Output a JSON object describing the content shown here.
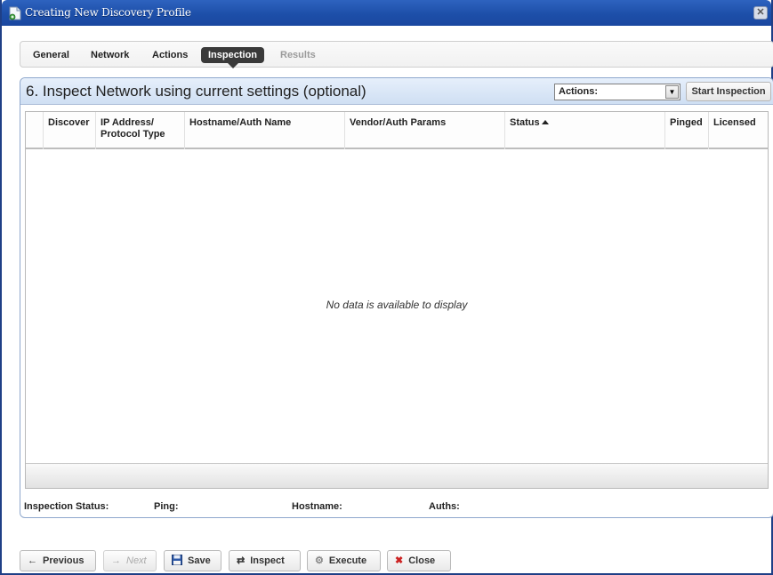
{
  "window": {
    "title": "Creating New Discovery Profile",
    "close_glyph": "✕"
  },
  "tabs": [
    {
      "label": "General",
      "state": "normal"
    },
    {
      "label": "Network",
      "state": "normal"
    },
    {
      "label": "Actions",
      "state": "normal"
    },
    {
      "label": "Inspection",
      "state": "active"
    },
    {
      "label": "Results",
      "state": "disabled"
    }
  ],
  "panel": {
    "title": "6. Inspect Network using current settings (optional)",
    "actions_select": {
      "value": "Actions:"
    },
    "start_button": "Start Inspection"
  },
  "grid": {
    "columns": [
      {
        "line1": "",
        "line2": ""
      },
      {
        "line1": "Discover",
        "line2": ""
      },
      {
        "line1": "IP Address/",
        "line2": "Protocol Type"
      },
      {
        "line1": "Hostname/Auth Name",
        "line2": ""
      },
      {
        "line1": "Vendor/Auth Params",
        "line2": ""
      },
      {
        "line1": "Status",
        "line2": "",
        "sort": "ascending"
      },
      {
        "line1": "Pinged",
        "line2": ""
      },
      {
        "line1": "Licensed",
        "line2": ""
      }
    ],
    "rows": [],
    "empty_message": "No data is available to display"
  },
  "status_bar": {
    "inspection_status": "Inspection Status:",
    "ping": "Ping:",
    "hostname": "Hostname:",
    "auths": "Auths:"
  },
  "buttons": {
    "previous": "Previous",
    "next": "Next",
    "save": "Save",
    "inspect": "Inspect",
    "execute": "Execute",
    "close": "Close"
  },
  "colors": {
    "title_bar": "#1d4fa9",
    "panel_header": "#cfdff3",
    "active_tab": "#3a3a3a",
    "close_icon": "#cc2222"
  }
}
